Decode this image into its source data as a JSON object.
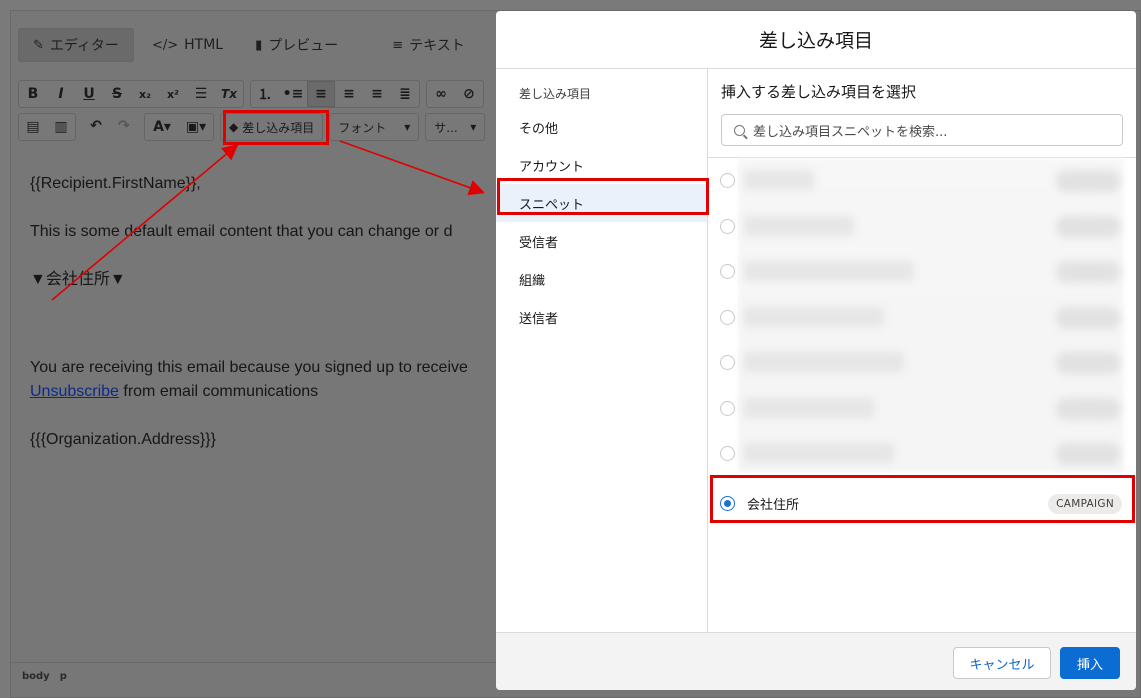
{
  "editor": {
    "tabs": [
      {
        "icon": "edit-icon",
        "label": "エディター"
      },
      {
        "icon": "code-icon",
        "label": "HTML"
      },
      {
        "icon": "document-icon",
        "label": "プレビュー"
      },
      {
        "icon": "text-lines-icon",
        "label": "テキスト"
      }
    ],
    "toolbar": {
      "bold": "B",
      "italic": "I",
      "underline": "U",
      "strike": "S",
      "subscript": "x₂",
      "superscript": "x²",
      "clear_format": "Tx",
      "merge_field_label": "差し込み項目",
      "font_select": "フォント",
      "size_select": "サ..."
    },
    "content": {
      "greeting": "{{Recipient.FirstName}},",
      "body": "This is some default email content that you can change or d",
      "address_marker": "▼会社住所▼",
      "footer_line": "You are receiving this email because you signed up to receive",
      "unsubscribe_link": "Unsubscribe",
      "unsubscribe_rest": " from email communications",
      "org_address": "{{{Organization.Address}}}"
    },
    "status": [
      "body",
      "p"
    ]
  },
  "modal": {
    "title": "差し込み項目",
    "nav_heading": "差し込み項目",
    "nav_items": [
      "その他",
      "アカウント",
      "スニペット",
      "受信者",
      "組織",
      "送信者"
    ],
    "active_nav": "スニペット",
    "picker_title": "挿入する差し込み項目を選択",
    "search_placeholder": "差し込み項目スニペットを検索...",
    "selected_item": {
      "label": "会社住所",
      "badge": "CAMPAIGN"
    },
    "cancel_label": "キャンセル",
    "insert_label": "挿入"
  },
  "colors": {
    "accent": "#0b6dd3",
    "highlight": "#e10000"
  }
}
